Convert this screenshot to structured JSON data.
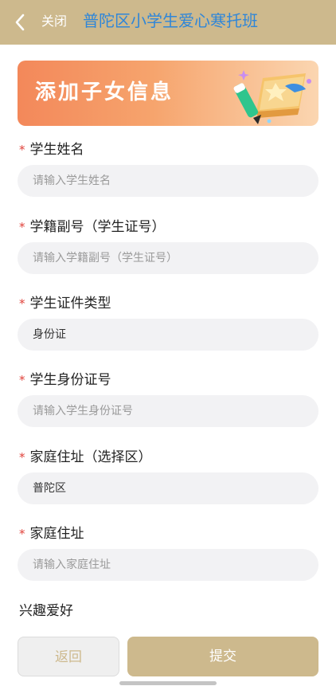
{
  "navbar": {
    "close_label": "关闭",
    "title": "普陀区小学生爱心寒托班",
    "bg_color": "#cdb98d",
    "title_color": "#2f86d8"
  },
  "banner": {
    "text": "添加子女信息",
    "illustration": "book-pencil-star-illustration"
  },
  "form": {
    "fields": [
      {
        "label": "学生姓名",
        "required": true,
        "value": "",
        "placeholder": "请输入学生姓名"
      },
      {
        "label": "学籍副号（学生证号）",
        "required": true,
        "value": "",
        "placeholder": "请输入学籍副号（学生证号）"
      },
      {
        "label": "学生证件类型",
        "required": true,
        "value": "身份证",
        "placeholder": ""
      },
      {
        "label": "学生身份证号",
        "required": true,
        "value": "",
        "placeholder": "请输入学生身份证号"
      },
      {
        "label": "家庭住址（选择区）",
        "required": true,
        "value": "普陀区",
        "placeholder": ""
      },
      {
        "label": "家庭住址",
        "required": true,
        "value": "",
        "placeholder": "请输入家庭住址"
      }
    ],
    "hobby_label": "兴趣爱好",
    "required_mark": "*"
  },
  "footer": {
    "back_label": "返回",
    "submit_label": "提交"
  }
}
